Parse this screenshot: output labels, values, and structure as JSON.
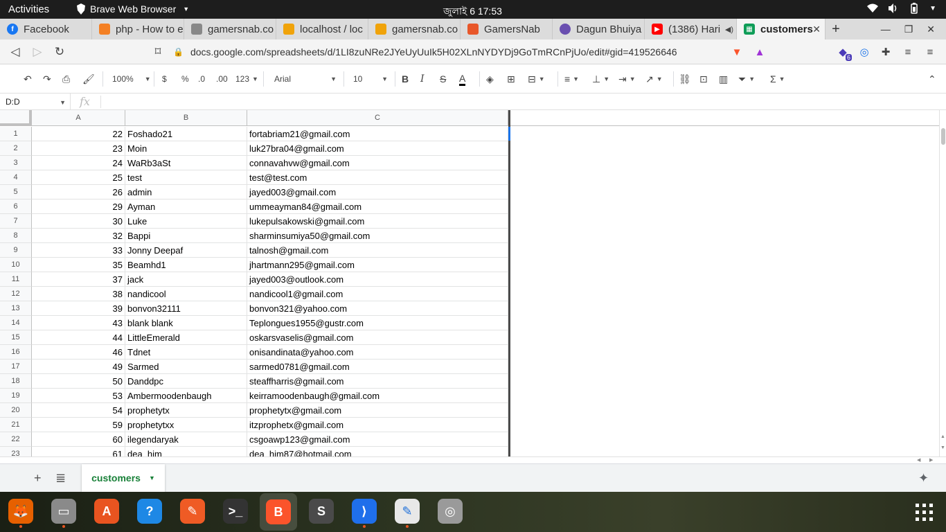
{
  "topbar": {
    "activities": "Activities",
    "app_menu": "Brave Web Browser",
    "clock": "জুলাই 6  17:53"
  },
  "tabs": [
    {
      "title": "Facebook",
      "color": "#1877f2"
    },
    {
      "title": "php - How to e",
      "color": "#f48024"
    },
    {
      "title": "gamersnab.co",
      "color": "#888888"
    },
    {
      "title": "localhost / loc",
      "color": "#f0a30a"
    },
    {
      "title": "gamersnab.co",
      "color": "#f0a30a"
    },
    {
      "title": "GamersNab",
      "color": "#e8572a"
    },
    {
      "title": "Dagun Bhuiya",
      "color": "#6a4fb0"
    },
    {
      "title": "(1386) Hari",
      "color": "#ff0000"
    },
    {
      "title": "customers",
      "color": "#0f9d58"
    }
  ],
  "address_bar": {
    "url": "docs.google.com/spreadsheets/d/1LI8zuNRe2JYeUyUuIk5H02XLnNYDYDj9GoTmRCnPjUo/edit#gid=419526646",
    "extension_badge": "6"
  },
  "toolbar": {
    "zoom": "100%",
    "currency": "$",
    "percent": "%",
    "dec_decrease": ".0",
    "dec_increase": ".00",
    "more_formats": "123",
    "font": "Arial",
    "font_size": "10"
  },
  "formula_bar": {
    "name_box": "D:D",
    "fx_label": "fx"
  },
  "columns": [
    "A",
    "B",
    "C"
  ],
  "rows": [
    {
      "num": "1",
      "a": "22",
      "b": "Foshado21",
      "c": "fortabriam21@gmail.com"
    },
    {
      "num": "2",
      "a": "23",
      "b": "Moin",
      "c": "luk27bra04@gmail.com"
    },
    {
      "num": "3",
      "a": "24",
      "b": "WaRb3aSt",
      "c": "connavahvw@gmail.com"
    },
    {
      "num": "4",
      "a": "25",
      "b": "test",
      "c": "test@test.com"
    },
    {
      "num": "5",
      "a": "26",
      "b": "admin",
      "c": "jayed003@gmail.com"
    },
    {
      "num": "6",
      "a": "29",
      "b": "Ayman",
      "c": "ummeayman84@gmail.com"
    },
    {
      "num": "7",
      "a": "30",
      "b": "Luke",
      "c": "lukepulsakowski@gmail.com"
    },
    {
      "num": "8",
      "a": "32",
      "b": "Bappi",
      "c": "sharminsumiya50@gmail.com"
    },
    {
      "num": "9",
      "a": "33",
      "b": "Jonny Deepaf",
      "c": "talnosh@gmail.com"
    },
    {
      "num": "10",
      "a": "35",
      "b": "Beamhd1",
      "c": "jhartmann295@gmail.com"
    },
    {
      "num": "11",
      "a": "37",
      "b": "jack",
      "c": "jayed003@outlook.com"
    },
    {
      "num": "12",
      "a": "38",
      "b": "nandicool",
      "c": "nandicool1@gmail.com"
    },
    {
      "num": "13",
      "a": "39",
      "b": "bonvon32111",
      "c": "bonvon321@yahoo.com"
    },
    {
      "num": "14",
      "a": "43",
      "b": "blank blank",
      "c": "Teplongues1955@gustr.com"
    },
    {
      "num": "15",
      "a": "44",
      "b": "LittleEmerald",
      "c": "oskarsvaselis@gmail.com"
    },
    {
      "num": "16",
      "a": "46",
      "b": "Tdnet",
      "c": "onisandinata@yahoo.com"
    },
    {
      "num": "17",
      "a": "49",
      "b": "Sarmed",
      "c": "sarmed0781@gmail.com"
    },
    {
      "num": "18",
      "a": "50",
      "b": "Danddpc",
      "c": "steaffharris@gmail.com"
    },
    {
      "num": "19",
      "a": "53",
      "b": "Ambermoodenbaugh",
      "c": "keirramoodenbaugh@gmail.com"
    },
    {
      "num": "20",
      "a": "54",
      "b": "prophetytx",
      "c": "prophetytx@gmail.com"
    },
    {
      "num": "21",
      "a": "59",
      "b": "prophetytxx",
      "c": "itzprophetx@gmail.com"
    },
    {
      "num": "22",
      "a": "60",
      "b": "ilegendaryak",
      "c": "csgoawp123@gmail.com"
    },
    {
      "num": "23",
      "a": "61",
      "b": "dea_him",
      "c": "dea_him87@hotmail.com"
    }
  ],
  "sheet_tab": "customers",
  "dock": [
    {
      "name": "firefox",
      "glyph": "🦊",
      "bg": "#e66000",
      "running": true
    },
    {
      "name": "files",
      "glyph": "▭",
      "bg": "#8a8a8a",
      "running": true
    },
    {
      "name": "software",
      "glyph": "A",
      "bg": "#e95420",
      "running": false
    },
    {
      "name": "help",
      "glyph": "?",
      "bg": "#1e88e5",
      "running": false
    },
    {
      "name": "postman",
      "glyph": "✎",
      "bg": "#ef5b25",
      "running": false
    },
    {
      "name": "terminal",
      "glyph": ">_",
      "bg": "#333333",
      "running": false
    },
    {
      "name": "brave",
      "glyph": "B",
      "bg": "#fb542b",
      "running": true
    },
    {
      "name": "sublime",
      "glyph": "S",
      "bg": "#4a4a4a",
      "running": false
    },
    {
      "name": "vscode",
      "glyph": "⟩",
      "bg": "#1f6feb",
      "running": true
    },
    {
      "name": "text-editor",
      "glyph": "✎",
      "bg": "#e8e8e8",
      "running": true
    },
    {
      "name": "disc",
      "glyph": "◎",
      "bg": "#9a9a9a",
      "running": false
    }
  ]
}
